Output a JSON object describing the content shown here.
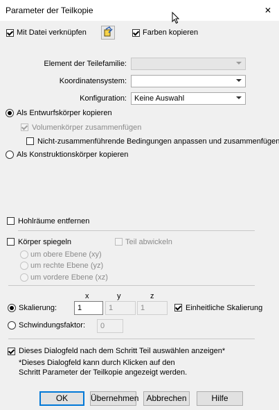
{
  "window": {
    "title": "Parameter der Teilkopie",
    "close_glyph": "✕"
  },
  "options": {
    "link_file": {
      "label": "Mit Datei verknüpfen",
      "checked": true
    },
    "copy_colors": {
      "label": "Farben kopieren",
      "checked": true
    }
  },
  "fields": {
    "family_element": {
      "label": "Element der Teilefamilie:",
      "value": ""
    },
    "coordinate_system": {
      "label": "Koordinatensystem:",
      "value": ""
    },
    "configuration": {
      "label": "Konfiguration:",
      "value": "Keine Auswahl"
    }
  },
  "copy_mode": {
    "design_body": {
      "label": "Als Entwurfskörper kopieren",
      "selected": true
    },
    "merge_solid": {
      "label": "Volumenkörper zusammenfügen",
      "checked": true,
      "disabled": true
    },
    "non_merging": {
      "label": "Nicht-zusammenführende Bedingungen anpassen und zusammenfügen",
      "checked": false
    },
    "construction_body": {
      "label": "Als Konstruktionskörper kopieren",
      "selected": false
    }
  },
  "remove_cavities": {
    "label": "Hohlräume entfernen",
    "checked": false
  },
  "mirror": {
    "label": "Körper spiegeln",
    "checked": false,
    "unfold": {
      "label": "Teil abwickeln",
      "checked": false
    },
    "planes": [
      "um obere Ebene (xy)",
      "um rechte Ebene (yz)",
      "um vordere Ebene (xz)"
    ]
  },
  "scaling": {
    "axis_headers": [
      "x",
      "y",
      "z"
    ],
    "label": "Skalierung:",
    "selected": true,
    "x": "1",
    "y": "1",
    "z": "1",
    "uniform": {
      "label": "Einheitliche Skalierung",
      "checked": true
    },
    "shrink": {
      "label": "Schwindungsfaktor:",
      "value": "0",
      "selected": false
    }
  },
  "footer_option": {
    "label": "Dieses Dialogfeld nach dem Schritt Teil auswählen anzeigen*",
    "checked": true,
    "note_line1": "*Dieses Dialogfeld kann durch Klicken auf den",
    "note_line2": "Schritt Parameter der Teilkopie angezeigt werden."
  },
  "buttons": {
    "ok": "OK",
    "apply": "Übernehmen",
    "cancel": "Abbrechen",
    "help": "Hilfe"
  }
}
